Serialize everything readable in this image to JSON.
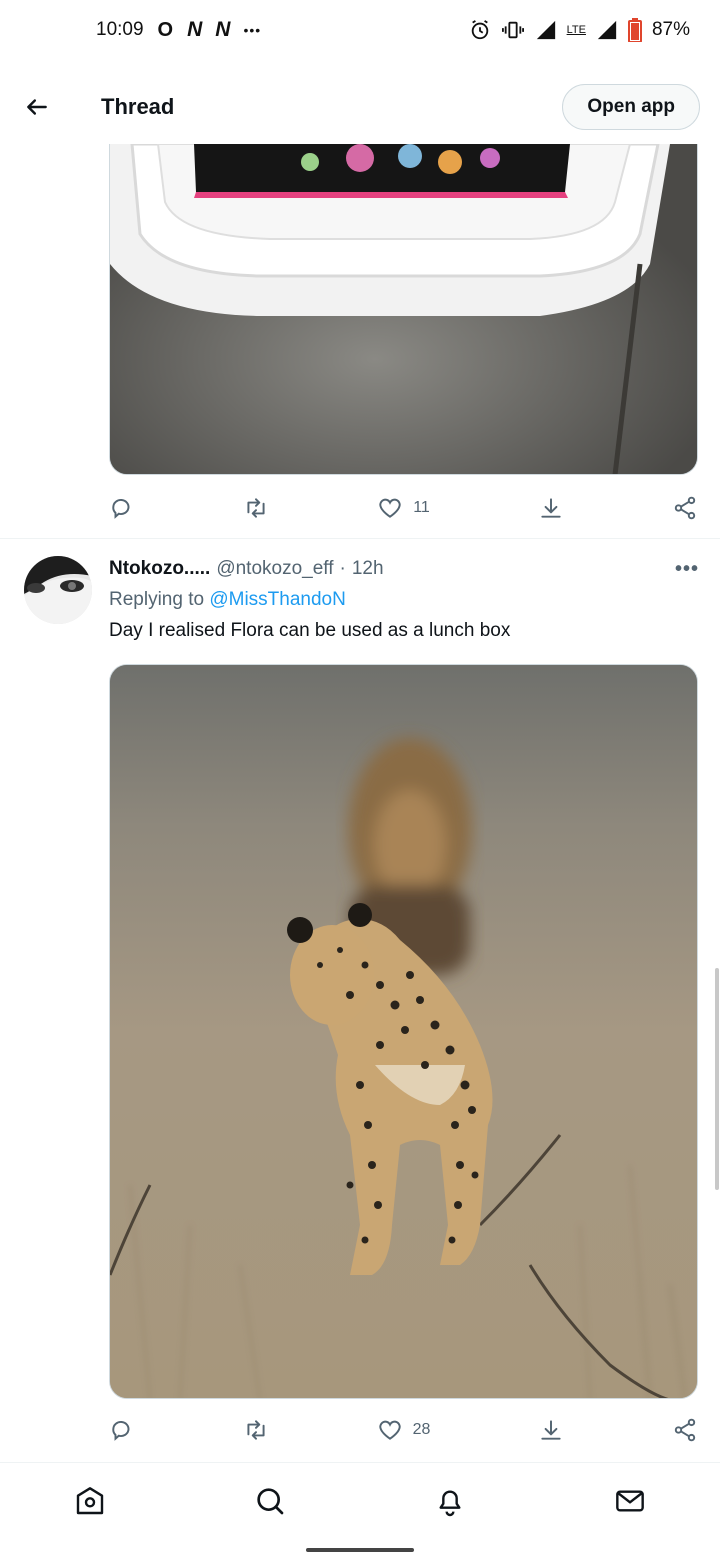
{
  "status_bar": {
    "time": "10:09",
    "icons": [
      "circle-o-icon",
      "n-icon",
      "n-icon",
      "more-dots-icon",
      "alarm-icon",
      "vibrate-icon",
      "signal-icon",
      "lte-icon",
      "signal-icon",
      "battery-icon"
    ],
    "glyph_o": "O",
    "glyph_n1": "N",
    "glyph_n2": "N",
    "dots": "•••",
    "network": "LTE",
    "battery": "87%"
  },
  "header": {
    "title": "Thread",
    "open_app_label": "Open app"
  },
  "tweet_top": {
    "retweets": "",
    "likes": "11"
  },
  "reply_tweet": {
    "display_name": "Ntokozo.....",
    "handle": "@ntokozo_eff",
    "separator": "·",
    "time": "12h",
    "replying_prefix": "Replying to",
    "replying_to": "@MissThandoN",
    "text": "Day I realised Flora can be used as a lunch box",
    "likes": "28",
    "more": "•••"
  },
  "bottom_nav": [
    "home-icon",
    "search-icon",
    "bell-icon",
    "mail-icon"
  ],
  "colors": {
    "link": "#1d9bf0",
    "secondary_text": "#536471",
    "primary_text": "#0f1419",
    "border": "#cfd9de"
  }
}
